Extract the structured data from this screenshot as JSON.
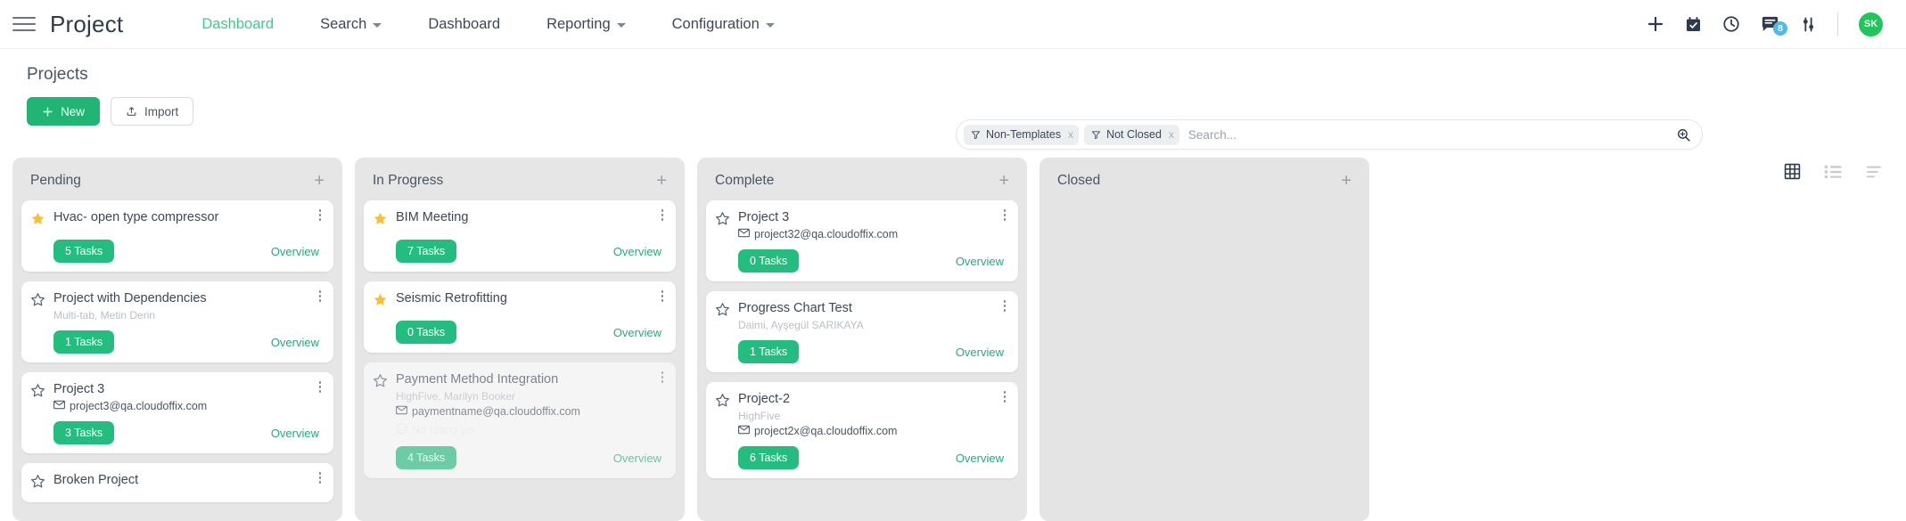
{
  "topnav": {
    "menu_icon": "hamburger-icon",
    "brand": "Project",
    "items": [
      {
        "label": "Dashboard",
        "active": true,
        "caret": false
      },
      {
        "label": "Search",
        "active": false,
        "caret": true
      },
      {
        "label": "Dashboard",
        "active": false,
        "caret": false
      },
      {
        "label": "Reporting",
        "active": false,
        "caret": true
      },
      {
        "label": "Configuration",
        "active": false,
        "caret": true
      }
    ],
    "actions": [
      {
        "name": "add-icon",
        "glyph": "plus"
      },
      {
        "name": "calendar-check-icon",
        "glyph": "calendar"
      },
      {
        "name": "clock-icon",
        "glyph": "clock"
      },
      {
        "name": "messages-icon",
        "glyph": "chat",
        "badge": "8"
      },
      {
        "name": "settings-sliders-icon",
        "glyph": "sliders"
      }
    ],
    "avatar_initials": "SK",
    "avatar_color": "#1fc75b",
    "accent_color": "#3dcb8c"
  },
  "subheader": {
    "title": "Projects",
    "new_label": "New",
    "import_label": "Import"
  },
  "search": {
    "placeholder": "Search...",
    "value": "",
    "chips": [
      {
        "label": "Non-Templates",
        "remove": "x"
      },
      {
        "label": "Not Closed",
        "remove": "x"
      }
    ]
  },
  "views": [
    {
      "name": "grid-view-icon",
      "active": true
    },
    {
      "name": "list-view-icon",
      "active": false
    },
    {
      "name": "lines-view-icon",
      "active": false
    }
  ],
  "board": {
    "columns": [
      {
        "title": "Pending",
        "add": "+",
        "empty": false,
        "cards": [
          {
            "title": "Hvac- open type compressor",
            "starred": true,
            "sub": "",
            "email": "",
            "rating": "",
            "tasks": "5 Tasks",
            "overview": "Overview",
            "ghost": false
          },
          {
            "title": "Project with Dependencies",
            "starred": false,
            "sub": "Multi-tab, Metin Derin",
            "email": "",
            "rating": "",
            "tasks": "1 Tasks",
            "overview": "Overview",
            "ghost": false
          },
          {
            "title": "Project 3",
            "starred": false,
            "sub": "",
            "email": "project3@qa.cloudoffix.com",
            "rating": "",
            "tasks": "3 Tasks",
            "overview": "Overview",
            "ghost": false
          },
          {
            "title": "Broken Project",
            "starred": false,
            "sub": "",
            "email": "",
            "rating": "",
            "tasks": "",
            "overview": "",
            "ghost": false
          }
        ]
      },
      {
        "title": "In Progress",
        "add": "+",
        "empty": false,
        "cards": [
          {
            "title": "BIM Meeting",
            "starred": true,
            "sub": "",
            "email": "",
            "rating": "",
            "tasks": "7 Tasks",
            "overview": "Overview",
            "ghost": false
          },
          {
            "title": "Seismic Retrofitting",
            "starred": true,
            "sub": "",
            "email": "",
            "rating": "",
            "tasks": "0 Tasks",
            "overview": "Overview",
            "ghost": false
          },
          {
            "title": "Payment Method Integration",
            "starred": false,
            "sub": "HighFive, Marilyn Booker",
            "email": "paymentname@qa.cloudoffix.com",
            "rating": "No rating yet",
            "tasks": "4 Tasks",
            "overview": "Overview",
            "ghost": true
          }
        ]
      },
      {
        "title": "Complete",
        "add": "+",
        "empty": false,
        "cards": [
          {
            "title": "Project 3",
            "starred": false,
            "sub": "",
            "email": "project32@qa.cloudoffix.com",
            "rating": "",
            "tasks": "0 Tasks",
            "overview": "Overview",
            "ghost": false
          },
          {
            "title": "Progress Chart Test",
            "starred": false,
            "sub": "Daimi, Ayşegül SARIKAYA",
            "email": "",
            "rating": "",
            "tasks": "1 Tasks",
            "overview": "Overview",
            "ghost": false
          },
          {
            "title": "Project-2",
            "starred": false,
            "sub": "HighFive",
            "email": "project2x@qa.cloudoffix.com",
            "rating": "",
            "tasks": "6 Tasks",
            "overview": "Overview",
            "ghost": false
          }
        ]
      },
      {
        "title": "Closed",
        "add": "+",
        "empty": true,
        "cards": []
      }
    ]
  }
}
